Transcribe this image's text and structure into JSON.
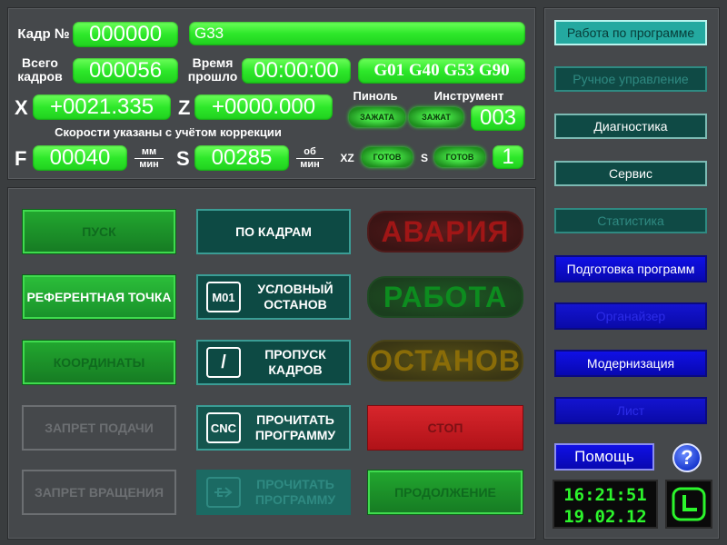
{
  "status": {
    "frame_label": "Кадр №",
    "frame_value": "000000",
    "command_value": "G33",
    "total_label_1": "Всего",
    "total_label_2": "кадров",
    "total_value": "000056",
    "time_label_1": "Время",
    "time_label_2": "прошло",
    "time_value": "00:00:00",
    "gcodes_value": "G01 G40 G53 G90",
    "x_label": "X",
    "x_value": "+0021.335",
    "z_label": "Z",
    "z_value": "+0000.000",
    "spindle_label": "Пиноль",
    "spindle_state": "ЗАЖАТА",
    "tool_label": "Инструмент",
    "tool_state": "ЗАЖАТ",
    "tool_value": "003",
    "speed_note": "Скорости указаны с учётом коррекции",
    "f_label": "F",
    "f_value": "00040",
    "f_unit_num": "мм",
    "f_unit_den": "мин",
    "s_label": "S",
    "s_value": "00285",
    "s_unit_num": "об",
    "s_unit_den": "мин",
    "xz_label": "XZ",
    "xz_state": "ГОТОВ",
    "s2_label": "S",
    "s2_state": "ГОТОВ",
    "s2_value": "1"
  },
  "controls": {
    "start": "ПУСК",
    "reference": "РЕФЕРЕНТНАЯ ТОЧКА",
    "coordinates": "КООРДИНАТЫ",
    "feed_lock": "ЗАПРЕТ ПОДАЧИ",
    "spin_lock": "ЗАПРЕТ ВРАЩЕНИЯ",
    "by_frames": "ПО КАДРАМ",
    "m01_badge": "M01",
    "cond_stop": "УСЛОВНЫЙ ОСТАНОВ",
    "skip_badge": "/",
    "skip_frames": "ПРОПУСК КАДРОВ",
    "cnc_badge": "CNC",
    "read_program": "ПРОЧИТАТЬ ПРОГРАММУ",
    "read_program_usb": "ПРОЧИТАТЬ ПРОГРАММУ",
    "stop": "СТОП",
    "continue": "ПРОДОЛЖЕНИЕ"
  },
  "lamps": {
    "alarm": "АВАРИЯ",
    "work": "РАБОТА",
    "halt": "ОСТАНОВ"
  },
  "sidebar": {
    "items": [
      {
        "label": "Работа по программе"
      },
      {
        "label": "Ручное управление"
      },
      {
        "label": "Диагностика"
      },
      {
        "label": "Сервис"
      },
      {
        "label": "Статистика"
      },
      {
        "label": "Подготовка программ"
      },
      {
        "label": "Органайзер"
      },
      {
        "label": "Модернизация"
      },
      {
        "label": "Лист"
      }
    ],
    "help": "Помощь",
    "help_icon": "?",
    "clock_time": "16:21:51",
    "clock_date": "19.02.12"
  },
  "colors": {
    "field_green": "#2ee82a",
    "panel": "#45484b",
    "teal": "#0f4a45",
    "blue": "#1010e6",
    "red": "#c81a20"
  }
}
